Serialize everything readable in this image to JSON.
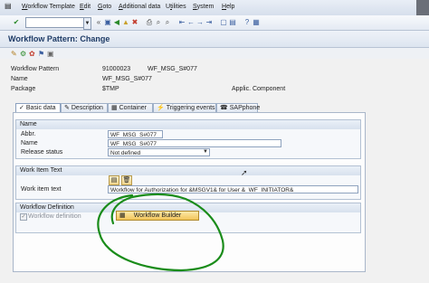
{
  "menu": {
    "items": [
      {
        "pre": "",
        "u": "W",
        "post": "orkflow Template"
      },
      {
        "pre": "",
        "u": "E",
        "post": "dit"
      },
      {
        "pre": "",
        "u": "G",
        "post": "oto"
      },
      {
        "pre": "",
        "u": "A",
        "post": "dditional data"
      },
      {
        "pre": "U",
        "u": "t",
        "post": "ilities"
      },
      {
        "pre": "",
        "u": "S",
        "post": "ystem"
      },
      {
        "pre": "",
        "u": "H",
        "post": "elp"
      }
    ]
  },
  "toolbar": {
    "icons": [
      "check-icon",
      "save-icon",
      "back-icon",
      "exit-icon",
      "cancel-icon",
      "print-icon",
      "find-icon",
      "find-next-icon",
      "first-page-icon",
      "prev-page-icon",
      "next-page-icon",
      "last-page-icon",
      "new-session-icon",
      "shortcut-icon",
      "help-icon",
      "customize-icon"
    ],
    "nav_arrow": "«"
  },
  "title": "Workflow Pattern: Change",
  "header": {
    "rows": [
      {
        "label": "Workflow Pattern",
        "value": "91000023",
        "value2": "WF_MSG_S#077"
      },
      {
        "label": "Name",
        "value": "WF_MSG_S#077"
      },
      {
        "label": "Package",
        "value": "$TMP",
        "value2_label": "Applic. Component"
      }
    ]
  },
  "tabs": [
    {
      "label": "Basic data",
      "icon": "✓",
      "active": true
    },
    {
      "label": "Description",
      "icon": "✎",
      "active": false
    },
    {
      "label": "Container",
      "icon": "▦",
      "active": false
    },
    {
      "label": "Triggering events",
      "icon": "⚡",
      "active": false
    },
    {
      "label": "SAPphone",
      "icon": "☎",
      "active": false
    }
  ],
  "name_group": {
    "title": "Name",
    "abbr_label": "Abbr.",
    "abbr_value": "WF_MSG_S#077",
    "name_label": "Name",
    "name_value": "WF_MSG_S#077",
    "release_label": "Release status",
    "release_value": "Not defined"
  },
  "work_item_group": {
    "title": "Work Item Text",
    "text_label": "Work item text",
    "text_value": "Workflow for Authorization for &MSGV1& for User &_WF_INITIATOR&"
  },
  "workflow_def_group": {
    "title": "Workflow Definition",
    "checkbox_label": "Workflow definition",
    "checked": true,
    "builder_button": "Workflow Builder"
  },
  "colors": {
    "annotation": "#1a8c1a",
    "title_text": "#1e3b66"
  }
}
